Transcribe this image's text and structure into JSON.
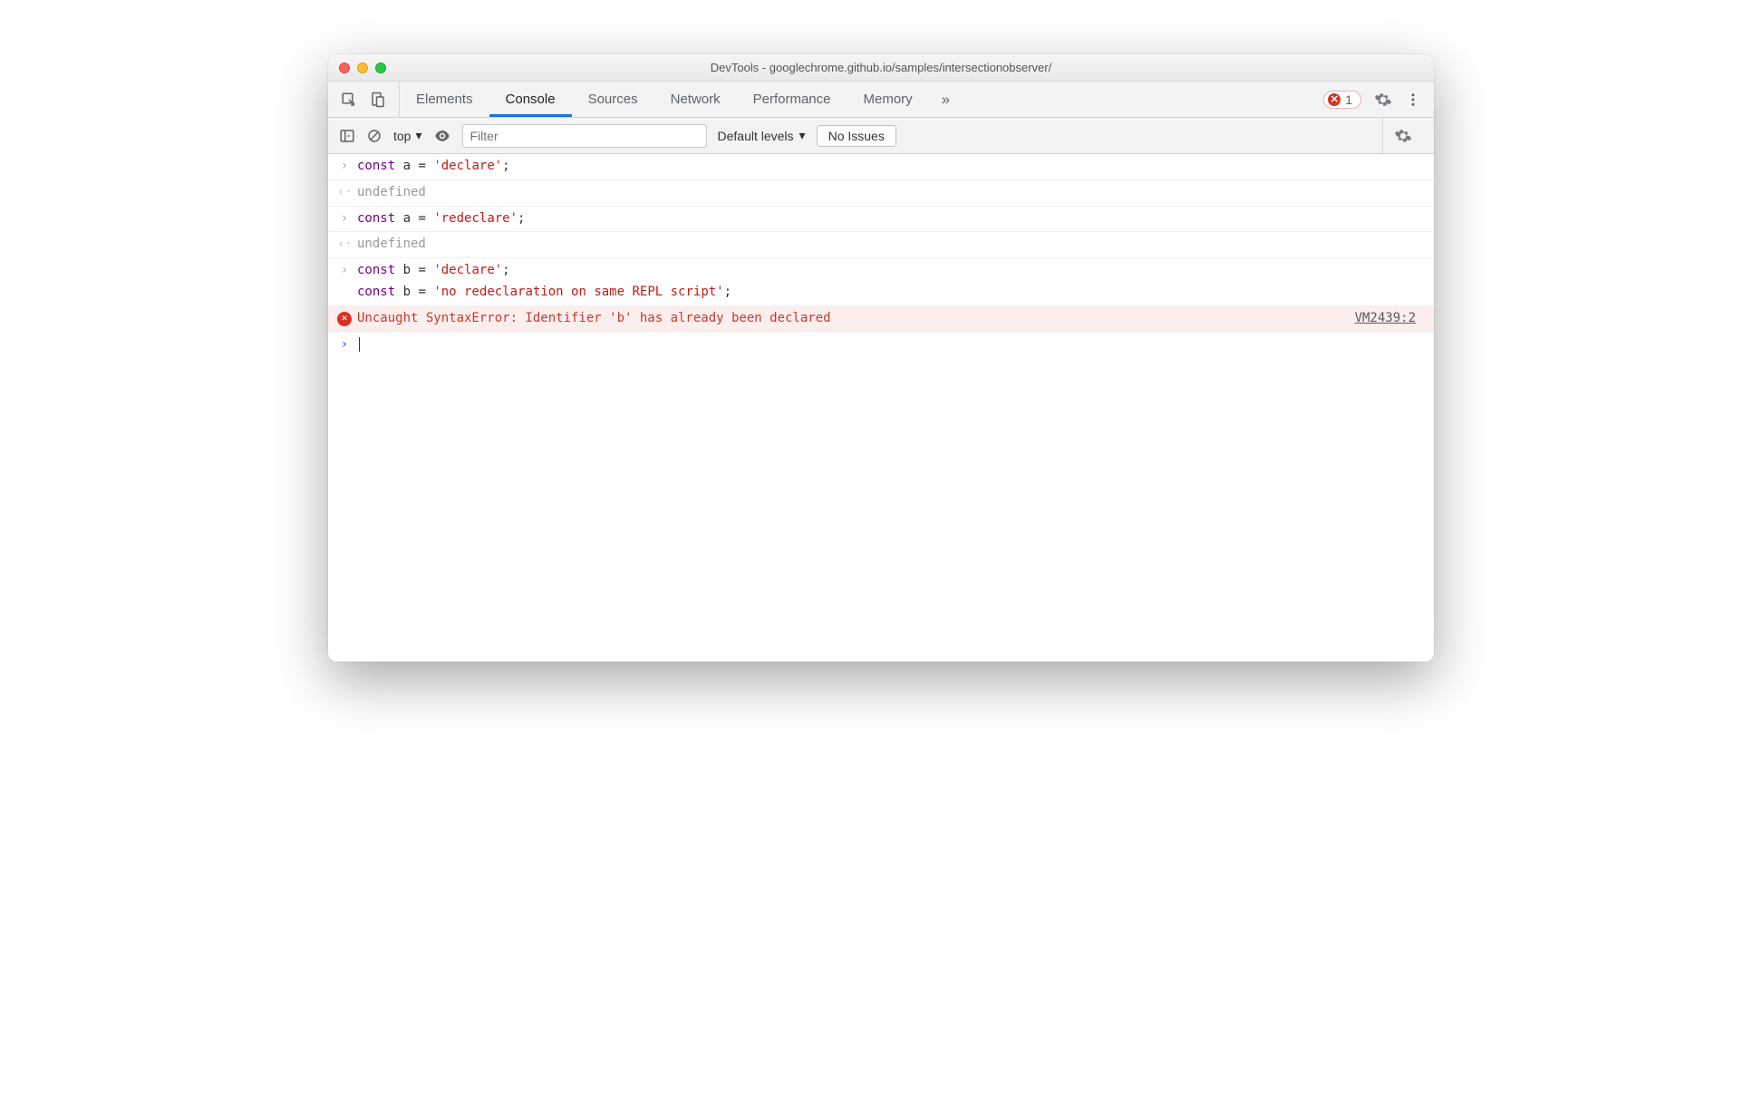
{
  "window": {
    "title": "DevTools - googlechrome.github.io/samples/intersectionobserver/"
  },
  "tabs": {
    "items": [
      "Elements",
      "Console",
      "Sources",
      "Network",
      "Performance",
      "Memory"
    ],
    "active": "Console",
    "overflow_glyph": "»",
    "error_count": "1"
  },
  "subbar": {
    "context": "top",
    "filter_placeholder": "Filter",
    "levels_label": "Default levels",
    "issues_label": "No Issues"
  },
  "console": {
    "entries": [
      {
        "k": "in",
        "tokens": [
          [
            "kw",
            "const"
          ],
          [
            "op",
            " a "
          ],
          [
            "op",
            "= "
          ],
          [
            "str",
            "'declare'"
          ],
          [
            "op",
            ";"
          ]
        ]
      },
      {
        "k": "out",
        "text": "undefined"
      },
      {
        "k": "in",
        "tokens": [
          [
            "kw",
            "const"
          ],
          [
            "op",
            " a "
          ],
          [
            "op",
            "= "
          ],
          [
            "str",
            "'redeclare'"
          ],
          [
            "op",
            ";"
          ]
        ]
      },
      {
        "k": "out",
        "text": "undefined"
      },
      {
        "k": "in-multi",
        "lines": [
          [
            [
              "kw",
              "const"
            ],
            [
              "op",
              " b "
            ],
            [
              "op",
              "= "
            ],
            [
              "str",
              "'declare'"
            ],
            [
              "op",
              ";"
            ]
          ],
          [
            [
              "kw",
              "const"
            ],
            [
              "op",
              " b "
            ],
            [
              "op",
              "= "
            ],
            [
              "str",
              "'no redeclaration on same REPL script'"
            ],
            [
              "op",
              ";"
            ]
          ]
        ]
      },
      {
        "k": "err",
        "text": "Uncaught SyntaxError: Identifier 'b' has already been declared",
        "src": "VM2439:2"
      }
    ]
  }
}
